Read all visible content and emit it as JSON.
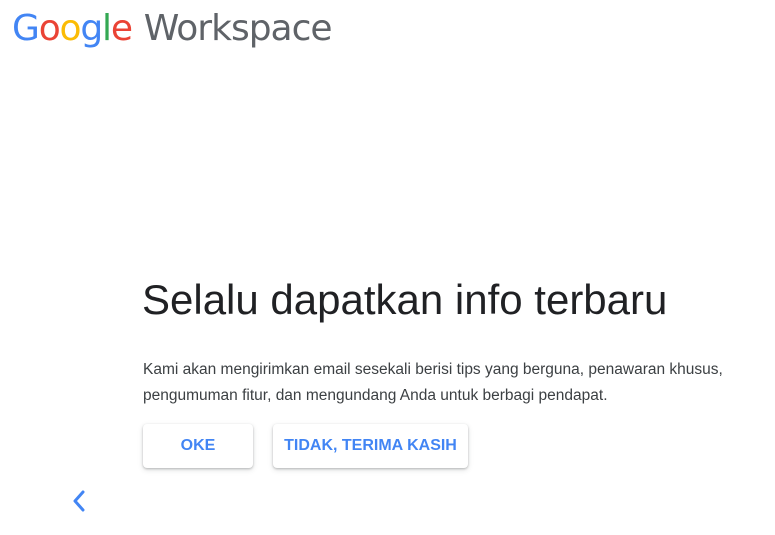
{
  "logo": {
    "brand_letters": [
      {
        "char": "G",
        "color": "#4285f4"
      },
      {
        "char": "o",
        "color": "#ea4335"
      },
      {
        "char": "o",
        "color": "#fbbc05"
      },
      {
        "char": "g",
        "color": "#4285f4"
      },
      {
        "char": "l",
        "color": "#34a853"
      },
      {
        "char": "e",
        "color": "#ea4335"
      }
    ],
    "product": "Workspace"
  },
  "main": {
    "title": "Selalu dapatkan info terbaru",
    "description": "Kami akan mengirimkan email sesekali berisi tips yang berguna, penawaran khusus, pengumuman fitur, dan mengundang Anda untuk berbagi pendapat."
  },
  "actions": {
    "ok_label": "OKE",
    "decline_label": "TIDAK, TERIMA KASIH"
  },
  "nav": {
    "back_icon": "chevron-left-icon"
  },
  "colors": {
    "accent": "#4285f4",
    "text_primary": "#202124",
    "text_secondary": "#3c4043",
    "logo_gray": "#5f6368"
  }
}
